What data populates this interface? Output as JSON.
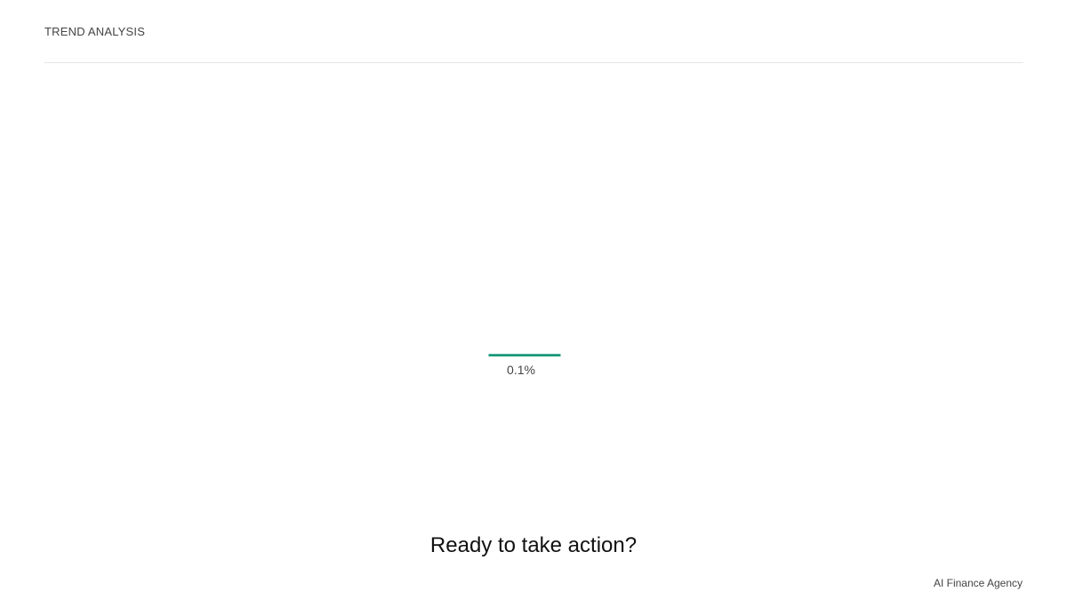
{
  "header": {
    "section_label": "TREND ANALYSIS"
  },
  "chart_data": {
    "type": "bar",
    "categories": [
      ""
    ],
    "values": [
      0.1
    ],
    "data_labels": [
      "0.1%"
    ],
    "color": "#1a9a7a"
  },
  "cta": {
    "heading": "Ready to take action?"
  },
  "footer": {
    "brand": "AI Finance Agency"
  },
  "colors": {
    "accent": "#1a9a7a",
    "divider": "#e6e6e6"
  }
}
